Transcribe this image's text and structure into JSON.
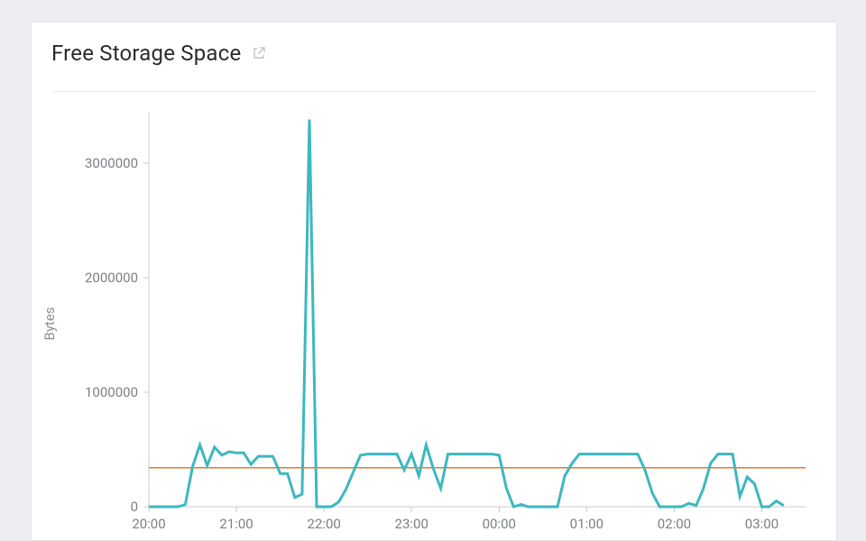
{
  "header": {
    "title": "Free Storage Space",
    "external_icon": "external-link-icon"
  },
  "chart_data": {
    "type": "line",
    "title": "",
    "xlabel": "",
    "ylabel": "Bytes",
    "ylim": [
      0,
      3400000
    ],
    "y_ticks": [
      0,
      1000000,
      2000000,
      3000000
    ],
    "x_ticks": [
      "20:00",
      "21:00",
      "22:00",
      "23:00",
      "00:00",
      "01:00",
      "02:00",
      "03:00"
    ],
    "x_start": "20:00",
    "x_end": "03:30",
    "threshold": 340000,
    "categories": [
      "20:00",
      "20:05",
      "20:10",
      "20:15",
      "20:20",
      "20:25",
      "20:30",
      "20:35",
      "20:40",
      "20:45",
      "20:50",
      "20:55",
      "21:00",
      "21:05",
      "21:10",
      "21:15",
      "21:20",
      "21:25",
      "21:30",
      "21:35",
      "21:40",
      "21:45",
      "21:50",
      "21:55",
      "22:00",
      "22:05",
      "22:10",
      "22:15",
      "22:20",
      "22:25",
      "22:30",
      "22:35",
      "22:40",
      "22:45",
      "22:50",
      "22:55",
      "23:00",
      "23:05",
      "23:10",
      "23:15",
      "23:20",
      "23:25",
      "23:30",
      "23:35",
      "23:40",
      "23:45",
      "23:50",
      "23:55",
      "00:00",
      "00:05",
      "00:10",
      "00:15",
      "00:20",
      "00:25",
      "00:30",
      "00:35",
      "00:40",
      "00:45",
      "00:50",
      "00:55",
      "01:00",
      "01:05",
      "01:10",
      "01:15",
      "01:20",
      "01:25",
      "01:30",
      "01:35",
      "01:40",
      "01:45",
      "01:50",
      "01:55",
      "02:00",
      "02:05",
      "02:10",
      "02:15",
      "02:20",
      "02:25",
      "02:30",
      "02:35",
      "02:40",
      "02:45",
      "02:50",
      "02:55",
      "03:00",
      "03:05",
      "03:10",
      "03:15",
      "03:20",
      "03:25",
      "03:30"
    ],
    "values": [
      0,
      0,
      0,
      0,
      0,
      20000,
      350000,
      540000,
      360000,
      520000,
      450000,
      480000,
      470000,
      470000,
      370000,
      440000,
      440000,
      440000,
      290000,
      290000,
      80000,
      110000,
      3380000,
      0,
      0,
      0,
      40000,
      150000,
      300000,
      450000,
      460000,
      460000,
      460000,
      460000,
      460000,
      320000,
      460000,
      270000,
      540000,
      330000,
      160000,
      460000,
      460000,
      460000,
      460000,
      460000,
      460000,
      460000,
      450000,
      160000,
      0,
      20000,
      0,
      0,
      0,
      0,
      0,
      270000,
      380000,
      460000,
      460000,
      460000,
      460000,
      460000,
      460000,
      460000,
      460000,
      460000,
      320000,
      120000,
      0,
      0,
      0,
      0,
      30000,
      10000,
      160000,
      380000,
      460000,
      460000,
      460000,
      90000,
      260000,
      200000,
      0,
      0,
      50000,
      10000
    ]
  }
}
